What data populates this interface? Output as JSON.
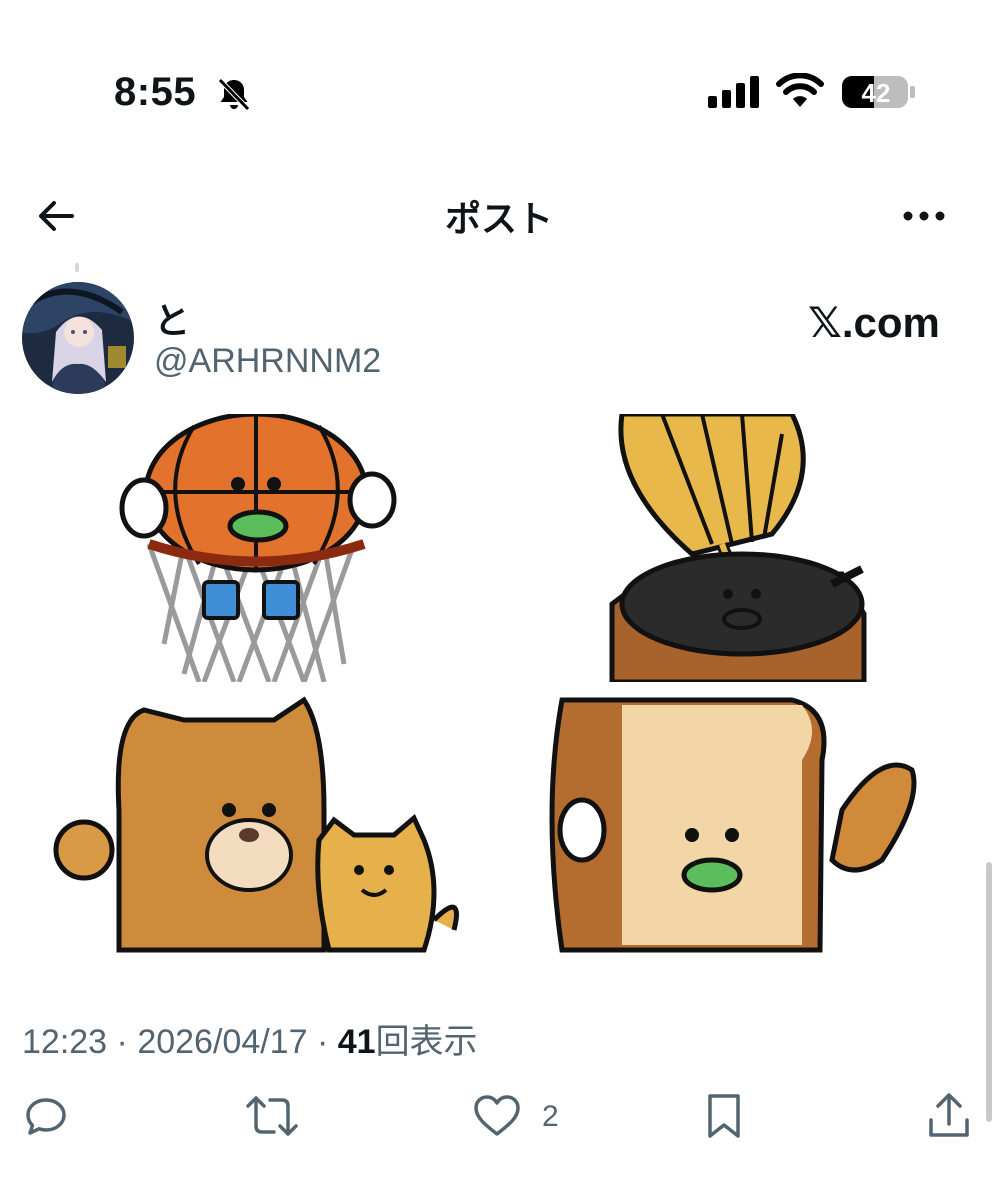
{
  "status_bar": {
    "time": "8:55",
    "battery": "42",
    "icons": [
      "bell-slash-icon",
      "signal-icon",
      "wifi-icon",
      "battery-icon"
    ]
  },
  "nav": {
    "title": "ポスト",
    "icons": [
      "back-arrow-icon",
      "more-icon"
    ]
  },
  "post": {
    "author_name": "と",
    "author_handle": "@ARHRNNM2",
    "source_label": "𝕏.com",
    "time": "12:23",
    "date": "2026/04/17",
    "sep": "·",
    "views_count": "41",
    "views_label": "回表示",
    "likes": "2",
    "action_icons": [
      "reply-icon",
      "retweet-icon",
      "like-icon",
      "bookmark-icon",
      "share-icon"
    ]
  },
  "colors": {
    "text": "#0f1419",
    "secondary": "#536471",
    "background": "#ffffff"
  }
}
